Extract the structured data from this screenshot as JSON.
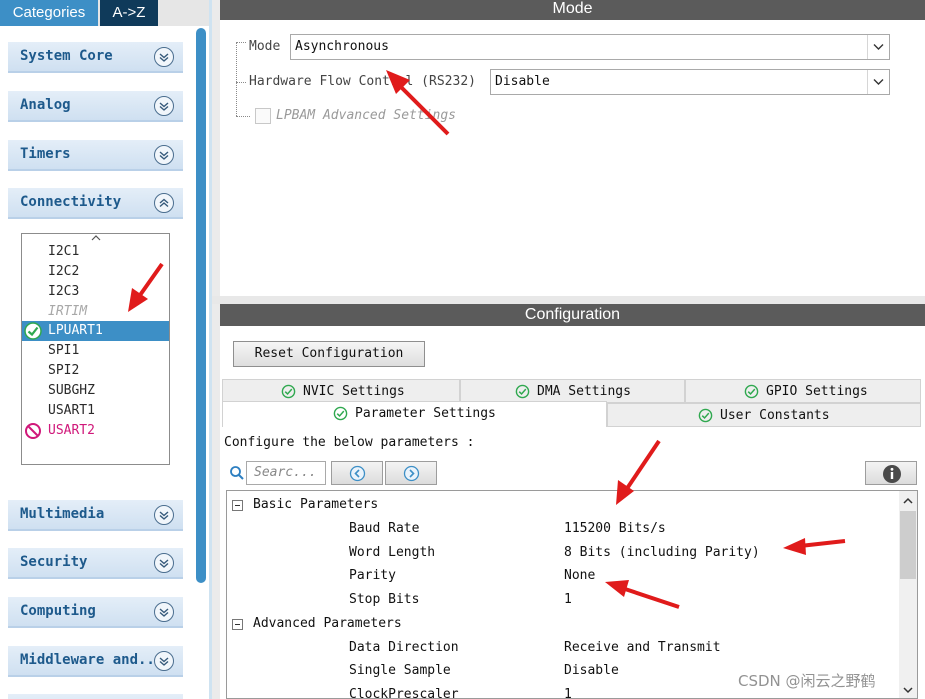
{
  "left_tabs": {
    "categories": "Categories",
    "az": "A->Z"
  },
  "categories": [
    {
      "label": "System Core",
      "state": "collapsed"
    },
    {
      "label": "Analog",
      "state": "collapsed"
    },
    {
      "label": "Timers",
      "state": "collapsed"
    },
    {
      "label": "Connectivity",
      "state": "expanded"
    },
    {
      "label": "Multimedia",
      "state": "collapsed"
    },
    {
      "label": "Security",
      "state": "collapsed"
    },
    {
      "label": "Computing",
      "state": "collapsed"
    },
    {
      "label": "Middleware and..",
      "state": "collapsed"
    }
  ],
  "connectivity_items": [
    {
      "label": "I2C1",
      "status": "normal"
    },
    {
      "label": "I2C2",
      "status": "normal"
    },
    {
      "label": "I2C3",
      "status": "normal"
    },
    {
      "label": "IRTIM",
      "status": "disabled"
    },
    {
      "label": "LPUART1",
      "status": "configured-selected"
    },
    {
      "label": "SPI1",
      "status": "normal"
    },
    {
      "label": "SPI2",
      "status": "normal"
    },
    {
      "label": "SUBGHZ",
      "status": "normal"
    },
    {
      "label": "USART1",
      "status": "normal"
    },
    {
      "label": "USART2",
      "status": "conflict"
    }
  ],
  "mode": {
    "title": "Mode",
    "mode_label": "Mode",
    "mode_value": "Asynchronous",
    "flow_label": "Hardware Flow Control (RS232)",
    "flow_value": "Disable",
    "lpbam_label": "LPBAM Advanced Settings",
    "lpbam_checked": false
  },
  "config": {
    "title": "Configuration",
    "reset_label": "Reset Configuration",
    "tabs_row1": [
      "NVIC Settings",
      "DMA Settings",
      "GPIO Settings"
    ],
    "tabs_row2": [
      "Parameter Settings",
      "User Constants"
    ],
    "active_tab": "Parameter Settings",
    "description": "Configure the below parameters :",
    "search_placeholder": "Searc...",
    "groups": [
      {
        "label": "Basic Parameters",
        "params": [
          {
            "name": "Baud Rate",
            "value": "115200 Bits/s"
          },
          {
            "name": "Word Length",
            "value": "8 Bits (including Parity)"
          },
          {
            "name": "Parity",
            "value": "None"
          },
          {
            "name": "Stop Bits",
            "value": "1"
          }
        ]
      },
      {
        "label": "Advanced Parameters",
        "params": [
          {
            "name": "Data Direction",
            "value": "Receive and Transmit"
          },
          {
            "name": "Single Sample",
            "value": "Disable"
          },
          {
            "name": "ClockPrescaler",
            "value": "1"
          }
        ]
      }
    ]
  },
  "colors": {
    "accent_blue": "#3d8fc6",
    "tab_dark": "#0f3a5a",
    "header_gray": "#5b5b5b",
    "annotation_red": "#e01b1b",
    "conflict_pink": "#d0187a",
    "ok_green": "#2fa84f"
  },
  "watermark": "CSDN @闲云之野鹤"
}
